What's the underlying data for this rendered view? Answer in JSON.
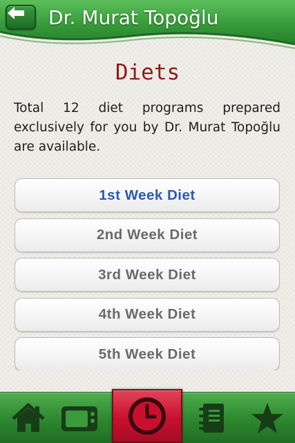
{
  "header": {
    "title": "Dr. Murat Topoğlu",
    "back_icon": "arrow-left-icon"
  },
  "page": {
    "title": "Diets",
    "intro": "Total 12 diet programs prepared exclusively for you by Dr. Murat Topoğlu are available."
  },
  "diets": [
    {
      "label": "1st Week Diet"
    },
    {
      "label": "2nd Week Diet"
    },
    {
      "label": "3rd Week Diet"
    },
    {
      "label": "4th Week Diet"
    },
    {
      "label": "5th Week Diet"
    }
  ],
  "tabs": [
    {
      "icon": "home-icon"
    },
    {
      "icon": "tv-icon"
    },
    {
      "icon": "clock-icon",
      "selected": true
    },
    {
      "icon": "notebook-icon"
    },
    {
      "icon": "star-icon"
    }
  ],
  "colors": {
    "green": "#2f8a31",
    "title_red": "#8d1b1b",
    "active_tab": "#c8102e",
    "active_item": "#2a5ab0"
  }
}
